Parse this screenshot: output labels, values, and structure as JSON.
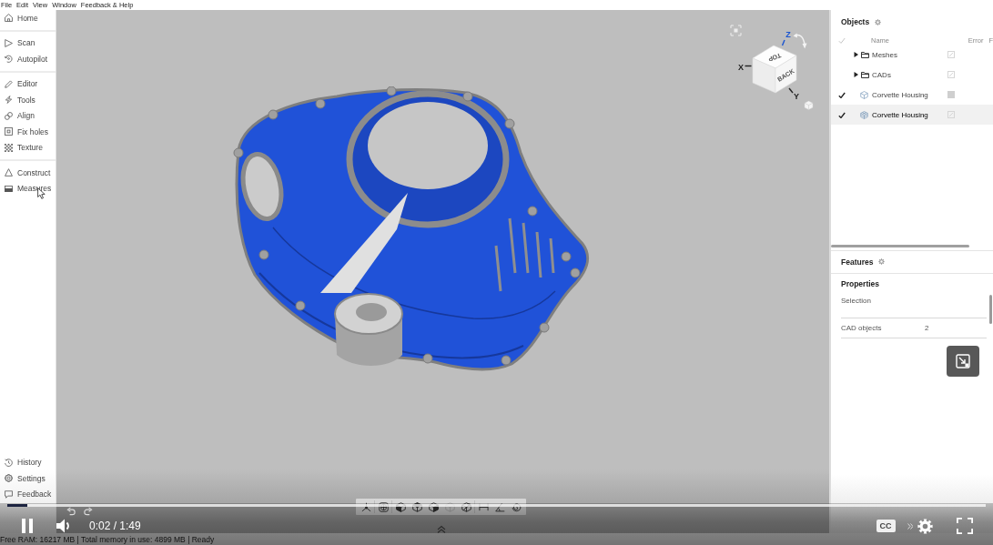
{
  "menu": [
    "File",
    "Edit",
    "View",
    "Window",
    "Feedback & Help"
  ],
  "sidebar": {
    "groups": [
      [
        {
          "label": "Home"
        }
      ],
      [
        {
          "label": "Scan"
        },
        {
          "label": "Autopilot"
        }
      ],
      [
        {
          "label": "Editor"
        },
        {
          "label": "Tools"
        },
        {
          "label": "Align"
        },
        {
          "label": "Fix holes"
        },
        {
          "label": "Texture"
        }
      ],
      [
        {
          "label": "Construct"
        },
        {
          "label": "Measures"
        }
      ]
    ],
    "footer": [
      {
        "label": "History"
      },
      {
        "label": "Settings"
      },
      {
        "label": "Feedback"
      }
    ]
  },
  "view_cube": {
    "faces": [
      "TOP",
      "BACK"
    ],
    "axes": [
      {
        "label": "X",
        "color": "#222222"
      },
      {
        "label": "Y",
        "color": "#222222"
      },
      {
        "label": "Z",
        "color": "#1a55d0"
      }
    ]
  },
  "undo_redo": [
    {
      "disabled": true
    },
    {
      "disabled": true
    }
  ],
  "toolbar": [
    [
      {
        "disabled": false
      }
    ],
    [
      {
        "disabled": false
      }
    ],
    [
      {
        "disabled": false
      },
      {
        "disabled": false
      },
      {
        "disabled": false
      },
      {
        "disabled": true
      },
      {
        "disabled": false
      }
    ],
    [
      {
        "disabled": false
      },
      {
        "disabled": false
      },
      {
        "disabled": false
      }
    ]
  ],
  "objects": {
    "title": "Objects",
    "columns": [
      "Name",
      "Error",
      "F"
    ],
    "rows": [
      {
        "kind": "folder",
        "name": "Meshes",
        "checked": false,
        "expanded": false,
        "box_filled": false,
        "selected": false
      },
      {
        "kind": "folder",
        "name": "CADs",
        "checked": false,
        "expanded": false,
        "box_filled": false,
        "selected": false
      },
      {
        "kind": "cad",
        "name": "Corvette Housing",
        "checked": true,
        "box_filled": true,
        "selected": false
      },
      {
        "kind": "mesh",
        "name": "Corvette Housing",
        "checked": true,
        "box_filled": false,
        "selected": true
      }
    ]
  },
  "features": {
    "title": "Features"
  },
  "properties": {
    "title": "Properties",
    "section": "Selection",
    "rows": [
      {
        "label": "CAD objects",
        "value": "2"
      }
    ]
  },
  "status_bar": "Free RAM: 16217 MB | Total memory in use: 4899 MB | Ready",
  "player": {
    "playing": true,
    "level": 0.02,
    "time": "0:02 / 1:49",
    "captions": "CC"
  }
}
